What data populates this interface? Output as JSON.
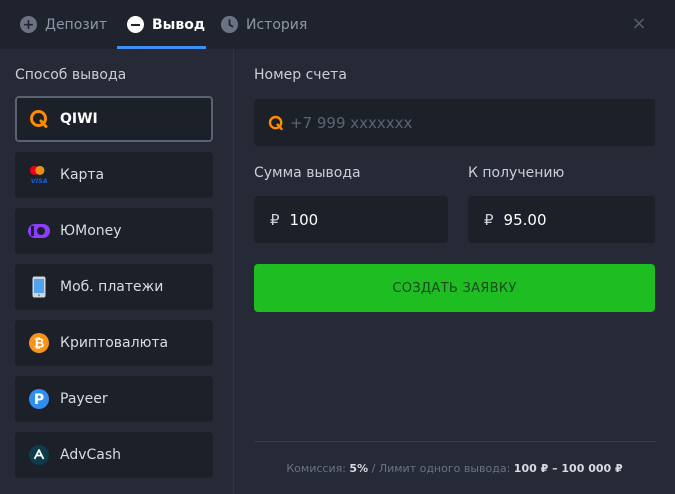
{
  "tabs": [
    {
      "label": "Депозит",
      "icon": "plus-circle-icon"
    },
    {
      "label": "Вывод",
      "icon": "minus-circle-icon"
    },
    {
      "label": "История",
      "icon": "clock-icon"
    }
  ],
  "close_icon": "×",
  "methods_title": "Способ вывода",
  "methods": [
    {
      "label": "QIWI",
      "icon": "qiwi-icon"
    },
    {
      "label": "Карта",
      "icon": "mastercard-visa-icon"
    },
    {
      "label": "ЮMoney",
      "icon": "yumoney-icon"
    },
    {
      "label": "Моб. платежи",
      "icon": "phone-icon"
    },
    {
      "label": "Криптовалюта",
      "icon": "bitcoin-icon"
    },
    {
      "label": "Payeer",
      "icon": "payeer-icon"
    },
    {
      "label": "AdvCash",
      "icon": "advcash-icon"
    }
  ],
  "account": {
    "label": "Номер счета",
    "placeholder": "+7 999 xxxxxxx"
  },
  "amount": {
    "label": "Сумма вывода",
    "currency": "₽",
    "value": "100"
  },
  "receive": {
    "label": "К получению",
    "currency": "₽",
    "value": "95.00"
  },
  "submit_label": "СОЗДАТЬ ЗАЯВКУ",
  "footer": {
    "commission_label": "Комиссия:",
    "commission_value": "5%",
    "separator": "/",
    "limit_label": "Лимит одного вывода:",
    "limit_value": "100 ₽ – 100 000 ₽"
  },
  "colors": {
    "accent": "#3d8ff5",
    "submit": "#1ebd22",
    "qiwi": "#ff8c00"
  }
}
